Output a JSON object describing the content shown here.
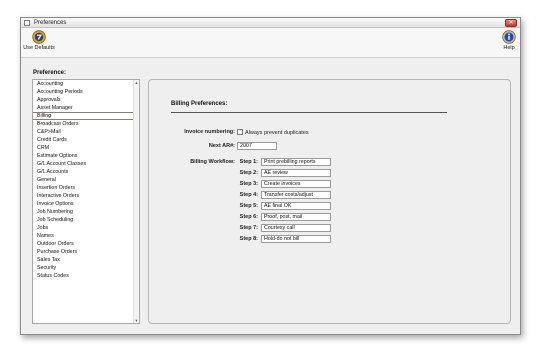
{
  "window": {
    "title": "Preferences",
    "close_glyph": "✕"
  },
  "toolbar": {
    "use_defaults_label": "Use Defaults",
    "help_label": "Help",
    "use_defaults_icon": "defaults-icon",
    "help_icon": "help-icon"
  },
  "sidebar": {
    "label": "Preference:",
    "items": [
      "Accounting",
      "Accounting Periods",
      "Approvals",
      "Asset Manager",
      "Billing",
      "Broadcast Orders",
      "C&P>Mail",
      "Credit Cards",
      "CRM",
      "Estimate Options",
      "G/L Account Classes",
      "G/L Accounts",
      "General",
      "Insertion Orders",
      "Interactive Orders",
      "Invoice Options",
      "Job Numbering",
      "Job Scheduling",
      "Jobs",
      "Names",
      "Outdoor Orders",
      "Purchase Orders",
      "Sales Tax",
      "Security",
      "Status Codes"
    ],
    "selected": "Billing"
  },
  "billing": {
    "section_title": "Billing Preferences:",
    "invoice_numbering_label": "Invoice numbering:",
    "prevent_duplicates_label": "Always prevent duplicates",
    "prevent_duplicates_checked": false,
    "next_ar_label": "Next AR#:",
    "next_ar_value": "2007",
    "workflow_label": "Billing Workflow:",
    "steps": [
      {
        "label": "Step 1:",
        "value": "Print prebilling reports"
      },
      {
        "label": "Step 2:",
        "value": "AE review"
      },
      {
        "label": "Step 3:",
        "value": "Create invoices"
      },
      {
        "label": "Step 4:",
        "value": "Transfer costs/adjust"
      },
      {
        "label": "Step 5:",
        "value": "AE final OK"
      },
      {
        "label": "Step 6:",
        "value": "Proof, post, mail"
      },
      {
        "label": "Step 7:",
        "value": "Courtesy call"
      },
      {
        "label": "Step 8:",
        "value": "Hold-do not bill"
      }
    ]
  },
  "colors": {
    "close_button": "#c4392a",
    "help_icon_fill": "#1f4fa8",
    "defaults_icon_fill": "#e0a020"
  }
}
